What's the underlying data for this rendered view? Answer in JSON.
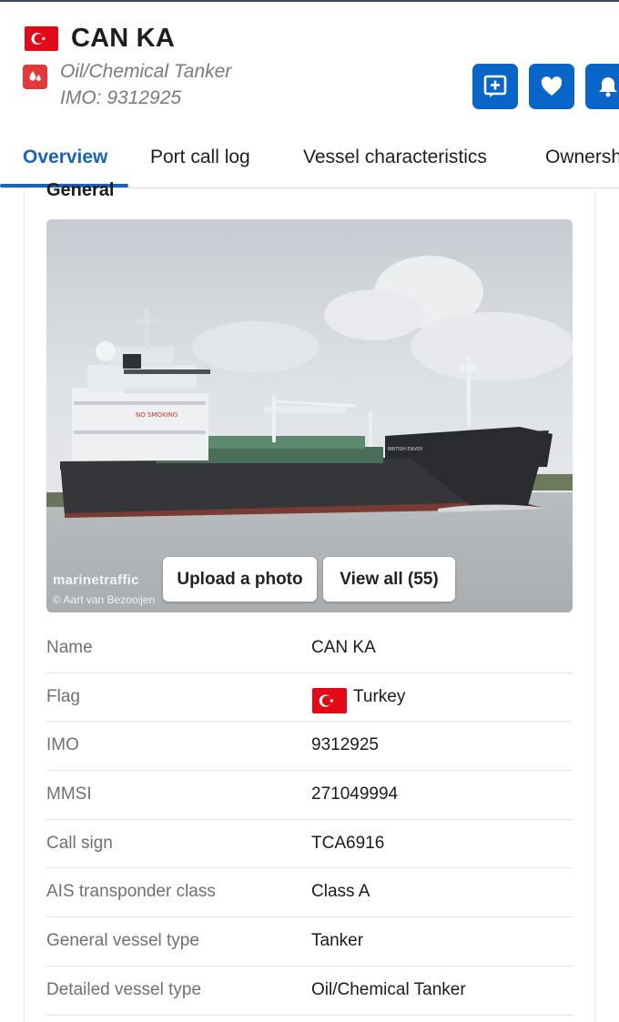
{
  "vessel": {
    "name": "CAN KA",
    "type": "Oil/Chemical Tanker",
    "imo_line": "IMO: 9312925",
    "flag_icon": "turkey-flag-icon"
  },
  "actions": [
    {
      "icon": "add-note-icon"
    },
    {
      "icon": "heart-icon"
    },
    {
      "icon": "bell-icon"
    }
  ],
  "tabs": [
    {
      "label": "Overview",
      "active": true
    },
    {
      "label": "Port call log",
      "active": false
    },
    {
      "label": "Vessel characteristics",
      "active": false
    },
    {
      "label": "Ownersh",
      "active": false
    }
  ],
  "section": {
    "title": "General"
  },
  "photo": {
    "watermark": "marinetraffic",
    "credit": "© Aart van Bezooijen",
    "upload_label": "Upload a photo",
    "view_all_label": "View all (55)"
  },
  "details": [
    {
      "key": "Name",
      "value": "CAN KA"
    },
    {
      "key": "Flag",
      "value": "Turkey"
    },
    {
      "key": "IMO",
      "value": "9312925"
    },
    {
      "key": "MMSI",
      "value": "271049994"
    },
    {
      "key": "Call sign",
      "value": "TCA6916"
    },
    {
      "key": "AIS transponder class",
      "value": "Class A"
    },
    {
      "key": "General vessel type",
      "value": "Tanker"
    },
    {
      "key": "Detailed vessel type",
      "value": "Oil/Chemical Tanker"
    }
  ],
  "colors": {
    "accent": "#0a65c9",
    "tab_active": "#1a64b8",
    "flag_red": "#e30a17",
    "type_icon_red": "#e2393a"
  }
}
